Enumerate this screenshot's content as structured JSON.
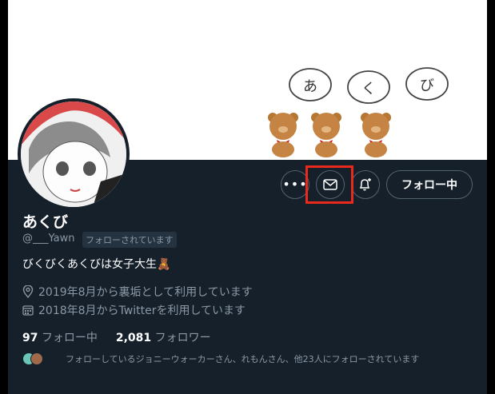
{
  "banner": {
    "bubble_chars": [
      "あ",
      "く",
      "び"
    ]
  },
  "profile": {
    "name": "あくび",
    "handle": "@___Yawn",
    "follows_you_badge": "フォローされています",
    "bio": "びくびくあくびは女子大生",
    "bio_emoji": "🧸",
    "location_text": "2019年8月から裏垢として利用しています",
    "joined_text": "2018年8月からTwitterを利用しています"
  },
  "actions": {
    "more_icon": "more-icon",
    "message_icon": "mail-icon",
    "notify_icon": "bell-plus-icon",
    "follow_label": "フォロー中"
  },
  "stats": {
    "following_count": "97",
    "following_label": "フォロー中",
    "followers_count": "2,081",
    "followers_label": "フォロワー"
  },
  "followed_by_text": "フォローしているジョニーウォーカーさん、れもんさん、他23人にフォローされています",
  "colors": {
    "background": "#15202b",
    "text_primary": "#ffffff",
    "text_secondary": "#8b98a5",
    "border": "#536471",
    "highlight": "#e8291c"
  }
}
